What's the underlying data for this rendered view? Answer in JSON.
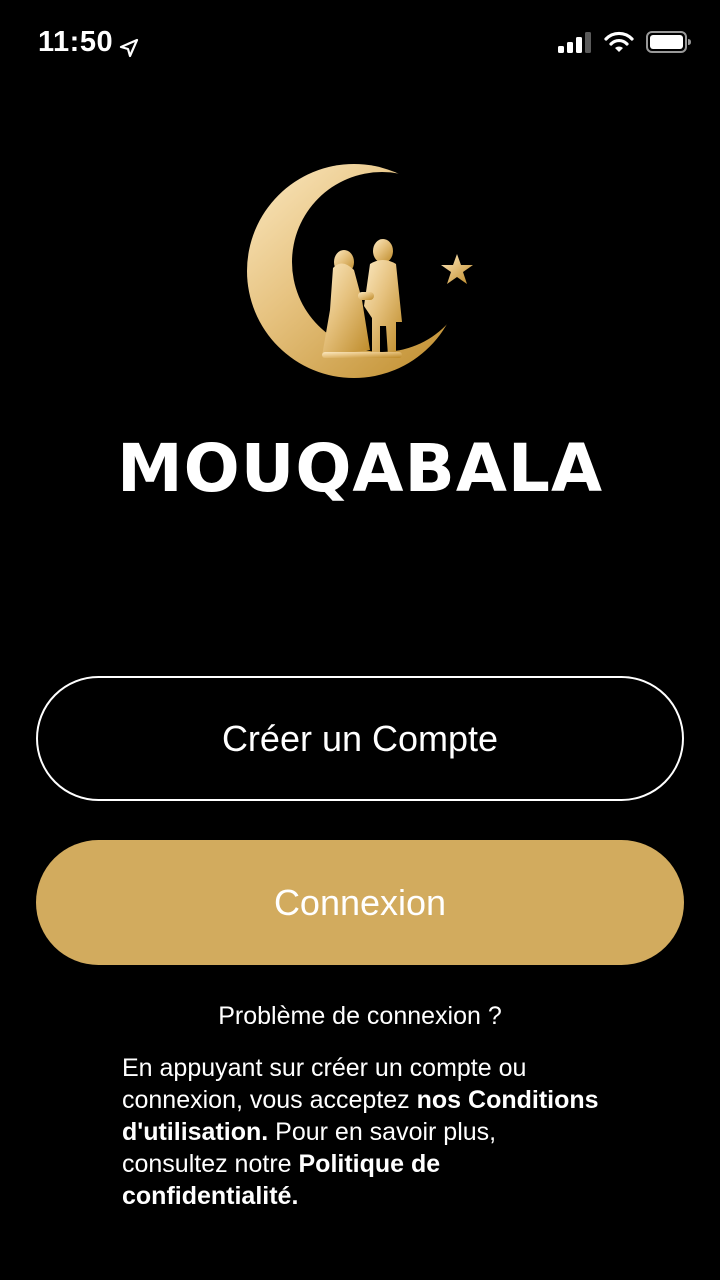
{
  "status_bar": {
    "time": "11:50"
  },
  "brand": {
    "name": "MOUQABALA",
    "gold": "#D2AB5E"
  },
  "buttons": {
    "create_account": "Créer un Compte",
    "login": "Connexion"
  },
  "links": {
    "login_problem": "Problème de connexion ?"
  },
  "legal": {
    "part1": "En appuyant sur créer un compte ou connexion, vous acceptez ",
    "terms": "nos Conditions d'utilisation.",
    "part2": " Pour en savoir plus, consultez notre ",
    "privacy": "Politique de confidentialité."
  },
  "icons": [
    "location-arrow-icon",
    "cellular-signal-icon",
    "wifi-icon",
    "battery-icon",
    "crescent-couple-logo",
    "star-icon"
  ]
}
